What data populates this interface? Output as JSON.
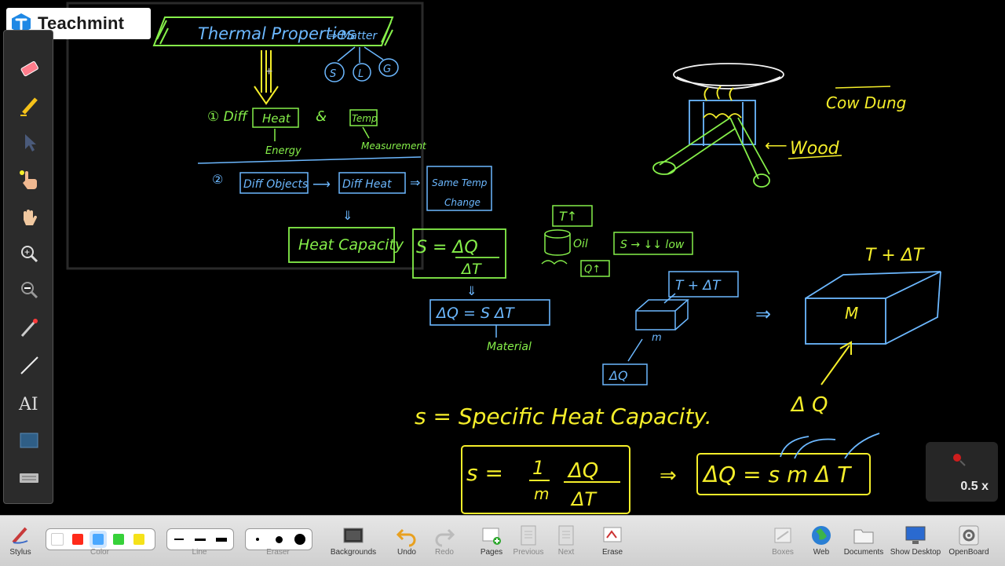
{
  "app": {
    "logo_text": "Teachmint",
    "brand_color": "#1e88e5"
  },
  "board": {
    "title": "Thermal Properties",
    "title_arrow": "⇒ Matter",
    "states": [
      "S",
      "L",
      "G"
    ],
    "note_1_prefix": "① Diff",
    "heat": "Heat",
    "amp": "&",
    "temp": "Temp",
    "energy": "Energy",
    "measurement": "Measurement",
    "note_2_prefix": "②",
    "diff_objects": "Diff Objects",
    "diff_heat": "Diff Heat",
    "same_temp": "Same Temp",
    "change": "Change",
    "heat_capacity": "Heat Capacity",
    "s_eq_top": "S = ΔQ",
    "s_eq_bottom": "ΔT",
    "dq_eq": "ΔQ = S ΔT",
    "material": "Material",
    "t_up": "T↑",
    "oil": "Oil",
    "qt": "Q↑",
    "s_low": "S → ↓↓ low",
    "t_plus_dt_small": "T + ΔT",
    "m_small": "m",
    "dq_small": "ΔQ",
    "t_plus_dt_big": "T + ΔT",
    "m_big": "M",
    "dq_big": "Δ Q",
    "cow_dung": "Cow Dung",
    "wood": "Wood",
    "arrow_wood": "⟵",
    "specific_def": "s = Specific Heat Capacity.",
    "formula_s": "s =",
    "formula_one": "1",
    "formula_m": "m",
    "formula_dq": "ΔQ",
    "formula_dt": "ΔT",
    "formula_implies": "⇒",
    "formula_final": "ΔQ = s m Δ T"
  },
  "zoom": {
    "level": "0.5 x"
  },
  "toolbar": {
    "stylus": "Stylus",
    "color": "Color",
    "line": "Line",
    "eraser": "Eraser",
    "backgrounds": "Backgrounds",
    "undo": "Undo",
    "redo": "Redo",
    "pages": "Pages",
    "previous": "Previous",
    "next": "Next",
    "erase": "Erase",
    "boxes": "Boxes",
    "web": "Web",
    "documents": "Documents",
    "show_desktop": "Show Desktop",
    "openboard": "OpenBoard"
  },
  "palette": [
    "#ffffff",
    "#ff2a1a",
    "#4aa8ff",
    "#37d13a",
    "#f5e21a"
  ],
  "ink": {
    "yellow": "#f5ee2a",
    "green": "#86f04a",
    "blue": "#6cb8ff",
    "white": "#f2f2f2"
  }
}
